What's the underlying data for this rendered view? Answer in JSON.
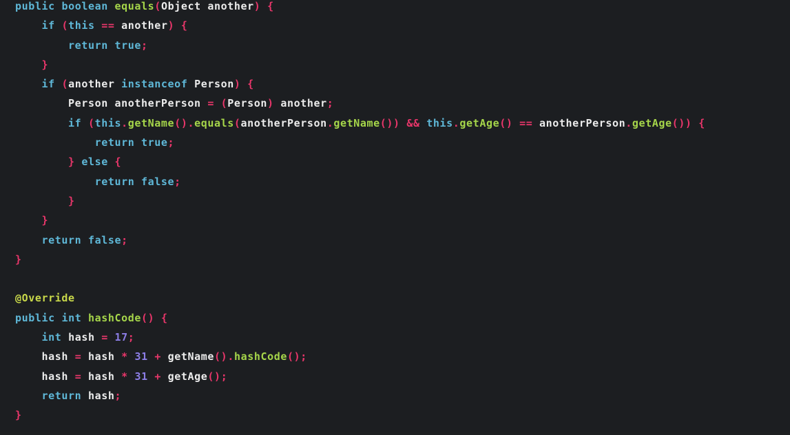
{
  "editor": {
    "colors": {
      "background": "#1c1e21",
      "keyword": "#5fb8d8",
      "function": "#a6d64a",
      "punctuation": "#e8366a",
      "identifier": "#ececec",
      "number": "#8c7ee6",
      "annotation": "#c9d94a"
    },
    "lines": [
      [
        [
          "kw",
          "public"
        ],
        [
          "ws",
          " "
        ],
        [
          "ty",
          "boolean"
        ],
        [
          "ws",
          " "
        ],
        [
          "fn",
          "equals"
        ],
        [
          "pu",
          "("
        ],
        [
          "id",
          "Object another"
        ],
        [
          "pu",
          ")"
        ],
        [
          "ws",
          " "
        ],
        [
          "pu",
          "{"
        ]
      ],
      [
        [
          "ws",
          "    "
        ],
        [
          "kw",
          "if"
        ],
        [
          "ws",
          " "
        ],
        [
          "pu",
          "("
        ],
        [
          "kw",
          "this"
        ],
        [
          "ws",
          " "
        ],
        [
          "op",
          "=="
        ],
        [
          "ws",
          " "
        ],
        [
          "id",
          "another"
        ],
        [
          "pu",
          ")"
        ],
        [
          "ws",
          " "
        ],
        [
          "pu",
          "{"
        ]
      ],
      [
        [
          "ws",
          "        "
        ],
        [
          "kw",
          "return"
        ],
        [
          "ws",
          " "
        ],
        [
          "kw",
          "true"
        ],
        [
          "pu",
          ";"
        ]
      ],
      [
        [
          "ws",
          "    "
        ],
        [
          "pu",
          "}"
        ]
      ],
      [
        [
          "ws",
          "    "
        ],
        [
          "kw",
          "if"
        ],
        [
          "ws",
          " "
        ],
        [
          "pu",
          "("
        ],
        [
          "id",
          "another"
        ],
        [
          "ws",
          " "
        ],
        [
          "kw",
          "instanceof"
        ],
        [
          "ws",
          " "
        ],
        [
          "id",
          "Person"
        ],
        [
          "pu",
          ")"
        ],
        [
          "ws",
          " "
        ],
        [
          "pu",
          "{"
        ]
      ],
      [
        [
          "ws",
          "        "
        ],
        [
          "id",
          "Person anotherPerson"
        ],
        [
          "ws",
          " "
        ],
        [
          "op",
          "="
        ],
        [
          "ws",
          " "
        ],
        [
          "pu",
          "("
        ],
        [
          "id",
          "Person"
        ],
        [
          "pu",
          ")"
        ],
        [
          "ws",
          " "
        ],
        [
          "id",
          "another"
        ],
        [
          "pu",
          ";"
        ]
      ],
      [
        [
          "ws",
          "        "
        ],
        [
          "kw",
          "if"
        ],
        [
          "ws",
          " "
        ],
        [
          "pu",
          "("
        ],
        [
          "kw",
          "this"
        ],
        [
          "pu",
          "."
        ],
        [
          "fn",
          "getName"
        ],
        [
          "pu",
          "()"
        ],
        [
          "pu",
          "."
        ],
        [
          "fn",
          "equals"
        ],
        [
          "pu",
          "("
        ],
        [
          "id",
          "anotherPerson"
        ],
        [
          "pu",
          "."
        ],
        [
          "fn",
          "getName"
        ],
        [
          "pu",
          "())"
        ],
        [
          "ws",
          " "
        ],
        [
          "op",
          "&&"
        ],
        [
          "ws",
          " "
        ],
        [
          "kw",
          "this"
        ],
        [
          "pu",
          "."
        ],
        [
          "fn",
          "getAge"
        ],
        [
          "pu",
          "()"
        ],
        [
          "ws",
          " "
        ],
        [
          "op",
          "=="
        ],
        [
          "ws",
          " "
        ],
        [
          "id",
          "anotherPerson"
        ],
        [
          "pu",
          "."
        ],
        [
          "fn",
          "getAge"
        ],
        [
          "pu",
          "())"
        ],
        [
          "ws",
          " "
        ],
        [
          "pu",
          "{"
        ]
      ],
      [
        [
          "ws",
          "            "
        ],
        [
          "kw",
          "return"
        ],
        [
          "ws",
          " "
        ],
        [
          "kw",
          "true"
        ],
        [
          "pu",
          ";"
        ]
      ],
      [
        [
          "ws",
          "        "
        ],
        [
          "pu",
          "}"
        ],
        [
          "ws",
          " "
        ],
        [
          "kw",
          "else"
        ],
        [
          "ws",
          " "
        ],
        [
          "pu",
          "{"
        ]
      ],
      [
        [
          "ws",
          "            "
        ],
        [
          "kw",
          "return"
        ],
        [
          "ws",
          " "
        ],
        [
          "kw",
          "false"
        ],
        [
          "pu",
          ";"
        ]
      ],
      [
        [
          "ws",
          "        "
        ],
        [
          "pu",
          "}"
        ]
      ],
      [
        [
          "ws",
          "    "
        ],
        [
          "pu",
          "}"
        ]
      ],
      [
        [
          "ws",
          "    "
        ],
        [
          "kw",
          "return"
        ],
        [
          "ws",
          " "
        ],
        [
          "kw",
          "false"
        ],
        [
          "pu",
          ";"
        ]
      ],
      [
        [
          "pu",
          "}"
        ]
      ],
      [],
      [
        [
          "an",
          "@Override"
        ]
      ],
      [
        [
          "kw",
          "public"
        ],
        [
          "ws",
          " "
        ],
        [
          "ty",
          "int"
        ],
        [
          "ws",
          " "
        ],
        [
          "fn",
          "hashCode"
        ],
        [
          "pu",
          "()"
        ],
        [
          "ws",
          " "
        ],
        [
          "pu",
          "{"
        ]
      ],
      [
        [
          "ws",
          "    "
        ],
        [
          "ty",
          "int"
        ],
        [
          "ws",
          " "
        ],
        [
          "id",
          "hash"
        ],
        [
          "ws",
          " "
        ],
        [
          "op",
          "="
        ],
        [
          "ws",
          " "
        ],
        [
          "nu",
          "17"
        ],
        [
          "pu",
          ";"
        ]
      ],
      [
        [
          "ws",
          "    "
        ],
        [
          "id",
          "hash"
        ],
        [
          "ws",
          " "
        ],
        [
          "op",
          "="
        ],
        [
          "ws",
          " "
        ],
        [
          "id",
          "hash"
        ],
        [
          "ws",
          " "
        ],
        [
          "op",
          "*"
        ],
        [
          "ws",
          " "
        ],
        [
          "nu",
          "31"
        ],
        [
          "ws",
          " "
        ],
        [
          "op",
          "+"
        ],
        [
          "ws",
          " "
        ],
        [
          "id",
          "getName"
        ],
        [
          "pu",
          "()"
        ],
        [
          "pu",
          "."
        ],
        [
          "fn",
          "hashCode"
        ],
        [
          "pu",
          "()"
        ],
        [
          "pu",
          ";"
        ]
      ],
      [
        [
          "ws",
          "    "
        ],
        [
          "id",
          "hash"
        ],
        [
          "ws",
          " "
        ],
        [
          "op",
          "="
        ],
        [
          "ws",
          " "
        ],
        [
          "id",
          "hash"
        ],
        [
          "ws",
          " "
        ],
        [
          "op",
          "*"
        ],
        [
          "ws",
          " "
        ],
        [
          "nu",
          "31"
        ],
        [
          "ws",
          " "
        ],
        [
          "op",
          "+"
        ],
        [
          "ws",
          " "
        ],
        [
          "id",
          "getAge"
        ],
        [
          "pu",
          "()"
        ],
        [
          "pu",
          ";"
        ]
      ],
      [
        [
          "ws",
          "    "
        ],
        [
          "kw",
          "return"
        ],
        [
          "ws",
          " "
        ],
        [
          "id",
          "hash"
        ],
        [
          "pu",
          ";"
        ]
      ],
      [
        [
          "pu",
          "}"
        ]
      ]
    ]
  }
}
